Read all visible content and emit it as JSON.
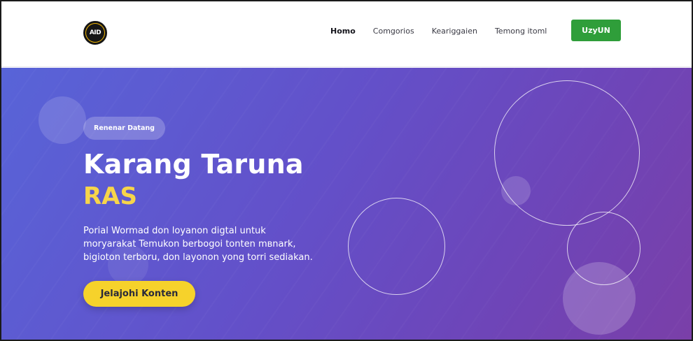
{
  "header": {
    "logo_text": "AID",
    "nav": [
      {
        "label": "Homo",
        "active": true
      },
      {
        "label": "Comgorios",
        "active": false
      },
      {
        "label": "Keariggaien",
        "active": false
      },
      {
        "label": "Temong itoml",
        "active": false
      }
    ],
    "cta_label": "UzyUN",
    "cta_color": "#2f9e3a"
  },
  "hero": {
    "badge": "Renenar Datang",
    "title": "Karang Taruna",
    "highlight": "RAS",
    "highlight_color": "#f7d54a",
    "description_lines": [
      "Porial Wormad don loyanon digtal untuk",
      "moryarakat Temukon berbogoi tonten mвnark,",
      "bigioton terboru, don layonon yong torri sediakan."
    ],
    "cta_label": "Jelajohi Konten",
    "cta_color": "#f6d22b"
  }
}
